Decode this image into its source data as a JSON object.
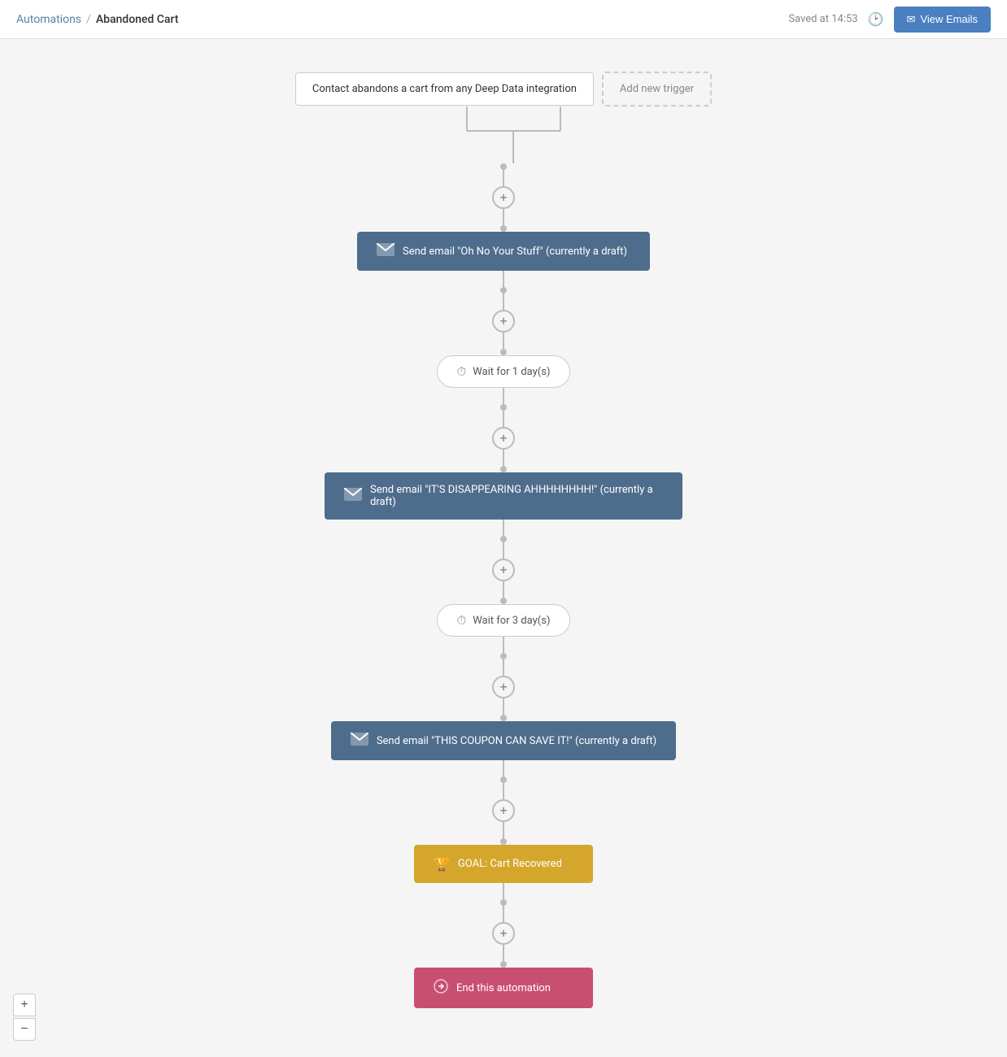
{
  "header": {
    "breadcrumb_link": "Automations",
    "breadcrumb_sep": "/",
    "breadcrumb_current": "Abandoned Cart",
    "saved_text": "Saved at 14:53",
    "view_emails_label": "View Emails"
  },
  "flow": {
    "trigger1_label": "Contact abandons a cart from any Deep Data integration",
    "trigger2_label": "Add new trigger",
    "step1_label": "Send email \"Oh No Your Stuff\" (currently a draft)",
    "wait1_label": "Wait for 1 day(s)",
    "step2_label": "Send email \"IT'S DISAPPEARING AHHHHHHHH!\" (currently a draft)",
    "wait2_label": "Wait for 3 day(s)",
    "step3_label": "Send email \"THIS COUPON CAN SAVE IT!\" (currently a draft)",
    "goal_label": "GOAL: Cart Recovered",
    "end_label": "End this automation"
  },
  "zoom": {
    "plus_label": "+",
    "minus_label": "−"
  }
}
